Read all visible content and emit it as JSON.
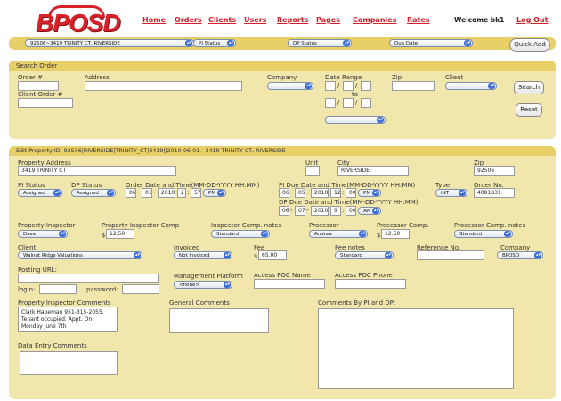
{
  "logo": {
    "text": "BPOSD"
  },
  "nav": {
    "home": "Home",
    "orders": "Orders",
    "clients": "Clients",
    "users": "Users",
    "reports": "Reports",
    "pages": "Pages",
    "companies": "Companies",
    "rates": "Rates",
    "welcome": "Welcome bk1",
    "logout": "Log Out"
  },
  "topbar": {
    "property": "92506~3419 TRINITY CT, RIVERSIDE",
    "pi_status": "PI Status",
    "dp_status": "DP Status",
    "due_date": "Due Date",
    "quick_add": "Quick Add"
  },
  "search": {
    "title": "Search Order",
    "order_label": "Order #",
    "address_label": "Address",
    "company_label": "Company",
    "date_range_label": "Date Range",
    "to_label": "to",
    "zip_label": "Zip",
    "client_label": "Client",
    "client_order_label": "Client Order #",
    "search_btn": "Search",
    "reset_btn": "Reset",
    "slash": "/"
  },
  "edit": {
    "title": "Edit Property ID: 92506|RIVERSIDE|TRINITY_CT|3419||2010-06-01 - 3419 TRINITY CT, RIVERSIDE",
    "property_address_label": "Property Address",
    "property_address": "3419 TRINITY CT",
    "unit_label": "Unit",
    "unit": "",
    "city_label": "City",
    "city": "RIVERSIDE",
    "zip_label": "Zip",
    "zip": "92506",
    "pi_status_label": "PI Status",
    "pi_status": "Assigned",
    "dp_status_label": "DP Status",
    "dp_status": "Assigned",
    "order_date_label": "Order Date and Time(MM-DD-YYYY HH:MM)",
    "order_month": "06",
    "order_day": "01",
    "order_year": "2010",
    "order_hour": "2",
    "order_min": "57",
    "order_ampm": "PM",
    "pi_due_label": "PI Due Date and Time(MM-DD-YYYY HH:MM)",
    "pi_month": "06",
    "pi_day": "05",
    "pi_year": "2010",
    "pi_hour": "12",
    "pi_min": "00",
    "pi_ampm": "PM",
    "dp_due_label": "DP Due Date and Time(MM-DD-YYYY HH:MM)",
    "dp_month": "06",
    "dp_day": "07",
    "dp_year": "2010",
    "dp_hour": "9",
    "dp_min": "00",
    "dp_ampm": "AM",
    "type_label": "Type",
    "type": "INT",
    "order_no_label": "Order No.",
    "order_no": "4081831",
    "inspector_label": "Property Inspector",
    "inspector": "Dave",
    "inspector_comp_label": "Property Inspector Comp",
    "inspector_comp": "12.50",
    "inspector_notes_label": "Inspector Comp. notes",
    "inspector_notes": "Standard",
    "processor_label": "Processor",
    "processor": "Andrea",
    "processor_comp_label": "Processor Comp.",
    "processor_comp": "12.50",
    "processor_notes_label": "Processor Comp. notes",
    "processor_notes": "Standard",
    "client_label": "Client",
    "client": "Walnut Ridge Valuations",
    "invoiced_label": "Invoiced",
    "invoiced": "Not Invoiced",
    "fee_label": "Fee",
    "fee": "65.00",
    "fee_notes_label": "Fee notes",
    "fee_notes": "Standard",
    "reference_label": "Reference No.",
    "reference": "",
    "company_label": "Company",
    "company": "BPOSD",
    "posting_url_label": "Posting URL:",
    "login_label": "login:",
    "password_label": "password:",
    "mgmt_label": "Management Platform",
    "mgmt": "<none>",
    "access_poc_name_label": "Access POC Name",
    "access_poc_phone_label": "Access POC Phone",
    "pi_comments_label": "Property Inspector Comments",
    "pi_comments": "Clark Hapeman 951-315-2055. Tenant occupied. Appt. On Monday June 7th",
    "general_comments_label": "General Comments",
    "comments_by_label": "Comments By PI and DP:",
    "data_entry_label": "Data Entry Comments",
    "dollar": "$",
    "dash": "-",
    "colon": ":"
  }
}
